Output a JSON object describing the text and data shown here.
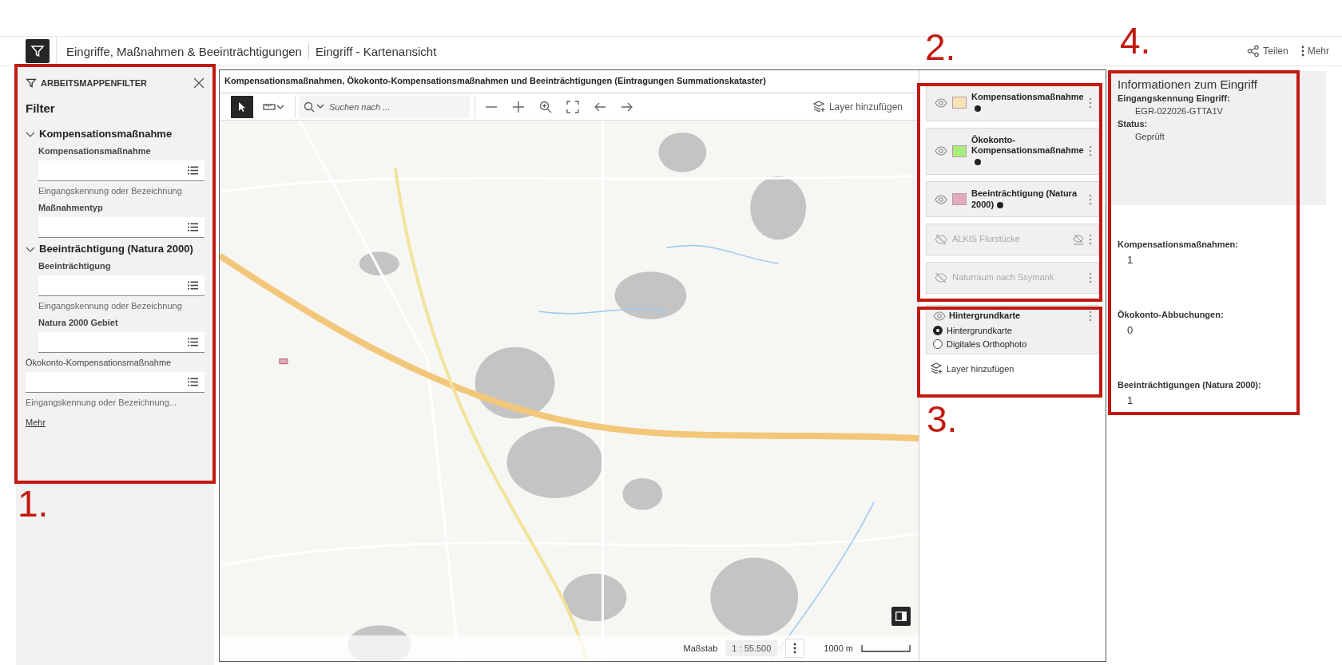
{
  "header": {
    "breadcrumbs": [
      "Eingriffe, Maßnahmen & Beeinträchtigungen",
      "Eingriff - Kartenansicht"
    ],
    "actions": [
      "Teilen",
      "Mehr"
    ]
  },
  "filter_panel": {
    "title": "ARBEITSMAPPENFILTER",
    "heading": "Filter",
    "groups": [
      {
        "title": "Kompensationsmaßnahme",
        "expanded": true,
        "fields": [
          {
            "label": "Kompensationsmaßnahme",
            "hint": "Eingangskennung oder Bezeichnung"
          },
          {
            "label": "Maßnahmentyp"
          }
        ]
      },
      {
        "title": "Beeinträchtigung (Natura 2000)",
        "expanded": true,
        "fields": [
          {
            "label": "Beeinträchtigung",
            "hint": "Eingangskennung oder Bezeichnung"
          },
          {
            "label": "Natura 2000 Gebiet"
          }
        ]
      }
    ],
    "extra_field": {
      "label": "Ökokonto-Kompensationsmaßnahme",
      "hint": "Eingangskennung oder Bezeichnung..."
    },
    "more_link": "Mehr"
  },
  "map": {
    "title": "Kompensationsmaßnahmen, Ökokonto-Kompensationsmaßnahmen und Beeinträchtigungen (Eintragungen Summationskataster)",
    "search": {
      "placeholder": "Suchen nach ..."
    },
    "add_layer": "Layer hinzufügen",
    "scale_label": "Maßstab",
    "scale_value": "1 : 55.500",
    "scale_bar": "1000 m"
  },
  "layers": {
    "items": [
      {
        "name": "Kompensationsmaßnahme",
        "visible": true,
        "color": "#f6e4b4",
        "out_of_range": false
      },
      {
        "name": "Ökokonto-Kompensationsmaßnahme",
        "visible": true,
        "color": "#a6ef7c",
        "out_of_range": false
      },
      {
        "name": "Beeinträchtigung (Natura 2000)",
        "visible": true,
        "color": "#e3aab9",
        "out_of_range": false
      },
      {
        "name": "ALKIS Flurstücke",
        "visible": false,
        "out_of_range": true
      },
      {
        "name": "Naturraum nach Ssymank",
        "visible": false,
        "out_of_range": false
      }
    ],
    "basemap": {
      "title": "Hintergrundkarte",
      "visible": true,
      "options": [
        {
          "label": "Hintergrundkarte",
          "selected": true
        },
        {
          "label": "Digitales Orthophoto",
          "selected": false
        }
      ]
    },
    "add_layer": "Layer hinzufügen"
  },
  "info_panel": {
    "title": "Informationen zum Eingriff",
    "fields": [
      {
        "label": "Eingangskennung Eingriff:",
        "value": "EGR-022026-GTTA1V"
      },
      {
        "label": "Status:",
        "value": "Geprüft"
      }
    ],
    "counts": [
      {
        "label": "Kompensationsmaßnahmen:",
        "value": "1"
      },
      {
        "label": "Ökokonto-Abbuchungen:",
        "value": "0"
      },
      {
        "label": "Beeinträchtigungen (Natura 2000):",
        "value": "1"
      }
    ]
  },
  "annotations": [
    {
      "number": "1."
    },
    {
      "number": "2."
    },
    {
      "number": "3."
    },
    {
      "number": "4."
    }
  ]
}
